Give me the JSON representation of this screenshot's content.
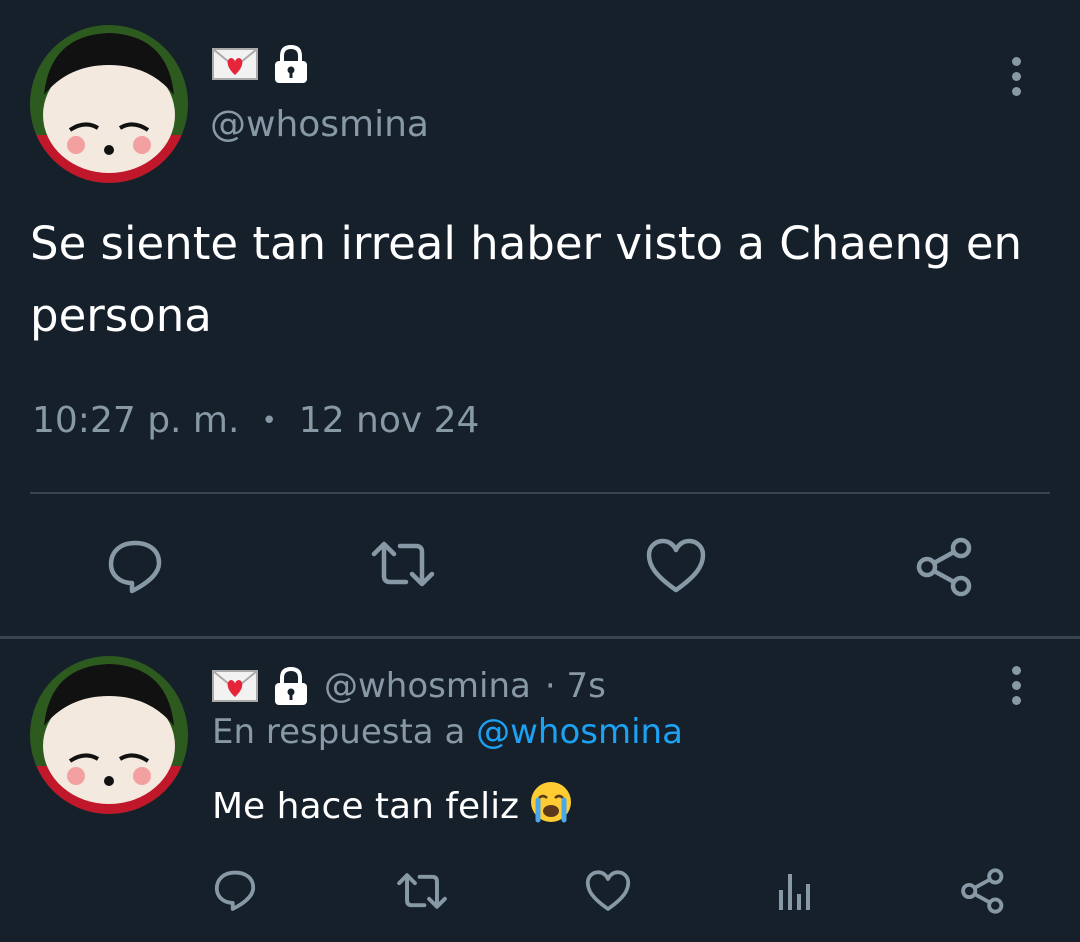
{
  "tweet": {
    "handle": "@whosmina",
    "text": "Se siente tan irreal haber visto a Chaeng en persona",
    "time": "10:27 p. m.",
    "separator": "•",
    "date": "12 nov 24",
    "badges": [
      "love-letter-emoji",
      "lock-icon"
    ]
  },
  "actions": [
    "reply-icon",
    "retweet-icon",
    "like-icon",
    "share-icon"
  ],
  "reply": {
    "handle": "@whosmina",
    "age": "· 7s",
    "reply_prefix": "En respuesta a",
    "reply_to": "@whosmina",
    "text": "Me hace tan feliz",
    "emoji": "😭",
    "actions": [
      "reply-icon",
      "retweet-icon",
      "like-icon",
      "analytics-icon",
      "share-icon"
    ]
  },
  "colors": {
    "background": "#15202b",
    "secondary_text": "#8899a6",
    "link": "#1da1f2",
    "divider": "#38444d"
  }
}
